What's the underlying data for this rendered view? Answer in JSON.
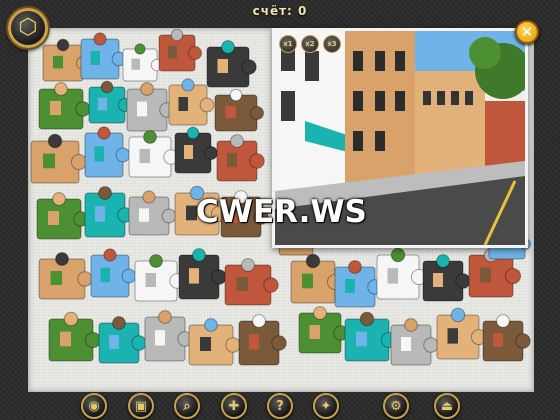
{
  "header": {
    "score_label": "счёт:",
    "score_value": "0"
  },
  "menu_button": {
    "icon": "game-menu-icon"
  },
  "preview": {
    "zoom_buttons": [
      "x1",
      "x2",
      "x3"
    ],
    "close_icon": "close-icon"
  },
  "watermark": "CWER.WS",
  "toolbar": {
    "buttons": [
      {
        "name": "eye-icon",
        "glyph": "◉"
      },
      {
        "name": "picture-icon",
        "glyph": "▣"
      },
      {
        "name": "magnifier-icon",
        "glyph": "⌕"
      },
      {
        "name": "sort-edges-icon",
        "glyph": "✚"
      },
      {
        "name": "hint-icon",
        "glyph": "?"
      },
      {
        "name": "magic-icon",
        "glyph": "✦"
      },
      {
        "name": "settings-gear-icon",
        "glyph": "⚙"
      },
      {
        "name": "exit-icon",
        "glyph": "⏏"
      }
    ]
  },
  "colors": {
    "frame_gold": "#c9a14a",
    "board_bg": "#e9e9e6",
    "sky": "#6fb3e8",
    "brick": "#d8a26a",
    "awning": "#1bb3b0"
  }
}
